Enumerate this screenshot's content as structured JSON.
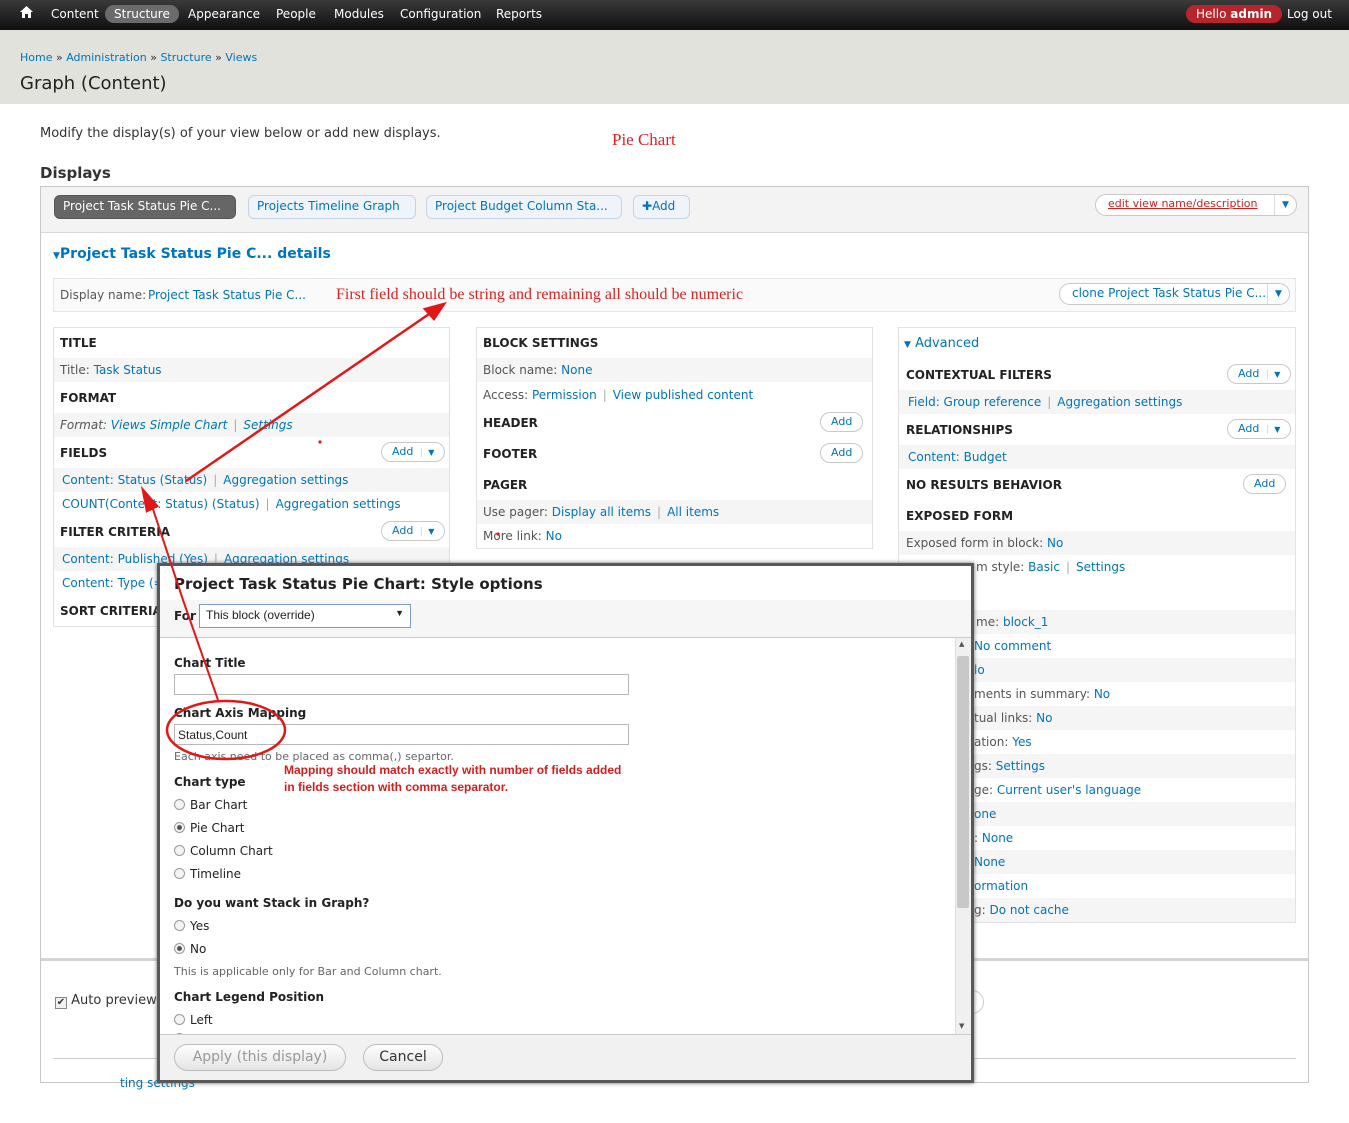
{
  "toolbar": {
    "items": [
      "Content",
      "Structure",
      "Appearance",
      "People",
      "Modules",
      "Configuration",
      "Reports"
    ],
    "hello_prefix": "Hello",
    "user": "admin",
    "logout": "Log out"
  },
  "breadcrumb": [
    "Home",
    "Administration",
    "Structure",
    "Views"
  ],
  "page_title": "Graph (Content)",
  "intro": "Modify the display(s) of your view below or add new displays.",
  "annotations": {
    "pie_chart": "Pie Chart",
    "first_field": "First field should be string and remaining all should be numeric",
    "mapping": "Mapping should match exactly with number of fields added in fields section with comma separator."
  },
  "displays": {
    "heading": "Displays",
    "tabs": [
      "Project Task Status Pie C...",
      "Projects Timeline Graph",
      "Project Budget Column Sta..."
    ],
    "add": "Add",
    "edit_name": "edit view name/description",
    "details_title": "Project Task Status Pie C... details",
    "display_name_label": "Display name:",
    "display_name_value": "Project Task Status Pie C...",
    "clone": "clone Project Task Status Pie C..."
  },
  "left_col": {
    "title_h": "TITLE",
    "title_label": "Title:",
    "title_value": "Task Status",
    "format_h": "FORMAT",
    "format_label": "Format:",
    "format_value": "Views Simple Chart",
    "format_settings": "Settings",
    "fields_h": "FIELDS",
    "field1": "Content: Status (Status)",
    "field2": "COUNT(Content: Status) (Status)",
    "aggregation": "Aggregation settings",
    "filter_h": "FILTER CRITERIA",
    "filter1": "Content: Published (Yes)",
    "filter2": "Content: Type (=",
    "sort_h": "SORT CRITERIA",
    "add": "Add"
  },
  "mid_col": {
    "block_h": "BLOCK SETTINGS",
    "block_name_label": "Block name:",
    "block_name_value": "None",
    "access_label": "Access:",
    "access_value": "Permission",
    "access_value2": "View published content",
    "header_h": "HEADER",
    "footer_h": "FOOTER",
    "pager_h": "PAGER",
    "use_pager_label": "Use pager:",
    "use_pager_value": "Display all items",
    "use_pager_value2": "All items",
    "more_link_label": "More link:",
    "more_link_value": "No",
    "add": "Add"
  },
  "right_col": {
    "advanced": "Advanced",
    "ctx_h": "CONTEXTUAL FILTERS",
    "ctx1": "Field: Group reference",
    "ctx1b": "Aggregation settings",
    "rel_h": "RELATIONSHIPS",
    "rel1": "Content: Budget",
    "nores_h": "NO RESULTS BEHAVIOR",
    "exp_h": "EXPOSED FORM",
    "exp_block_label": "Exposed form in block:",
    "exp_block_value": "No",
    "exp_style_label": "m style:",
    "exp_style_value": "Basic",
    "exp_style_value2": "Settings",
    "frag1_label": "me:",
    "frag1_value": "block_1",
    "frag2_value": "No comment",
    "frag3_value": "lo",
    "frag4_label": "ments in summary:",
    "frag4_value": "No",
    "frag5_label": "tual links:",
    "frag5_value": "No",
    "frag6_label": "ation:",
    "frag6_value": "Yes",
    "frag7_label": "gs:",
    "frag7_value": "Settings",
    "frag8_label": "ge:",
    "frag8_value": "Current user's language",
    "frag9_value": "one",
    "frag10_label": ":",
    "frag10_value": "None",
    "frag11_value": "None",
    "frag12_value": "ormation",
    "frag13_label": "g:",
    "frag13_value": "Do not cache",
    "add": "Add"
  },
  "auto_preview": "Auto preview",
  "footer_frag": "ting settings",
  "modal": {
    "title": "Project Task Status Pie Chart: Style options",
    "for_label": "For",
    "for_value": "This block (override)",
    "chart_title_label": "Chart Title",
    "chart_title_value": "",
    "axis_label": "Chart Axis Mapping",
    "axis_value": "Status,Count",
    "axis_desc": "Each axis need to be placed as comma(,) separtor.",
    "chart_type_label": "Chart type",
    "chart_types": [
      "Bar Chart",
      "Pie Chart",
      "Column Chart",
      "Timeline"
    ],
    "chart_type_selected": "Pie Chart",
    "stack_label": "Do you want Stack in Graph?",
    "stack_options": [
      "Yes",
      "No"
    ],
    "stack_selected": "No",
    "stack_desc": "This is applicable only for Bar and Column chart.",
    "legend_label": "Chart Legend Position",
    "legend_options": [
      "Left"
    ],
    "apply": "Apply (this display)",
    "cancel": "Cancel"
  },
  "colors": {
    "accent": "#0074bd",
    "annotation": "#e02020",
    "toolbar": "#1a1a1a",
    "hello": "#b8242c"
  }
}
